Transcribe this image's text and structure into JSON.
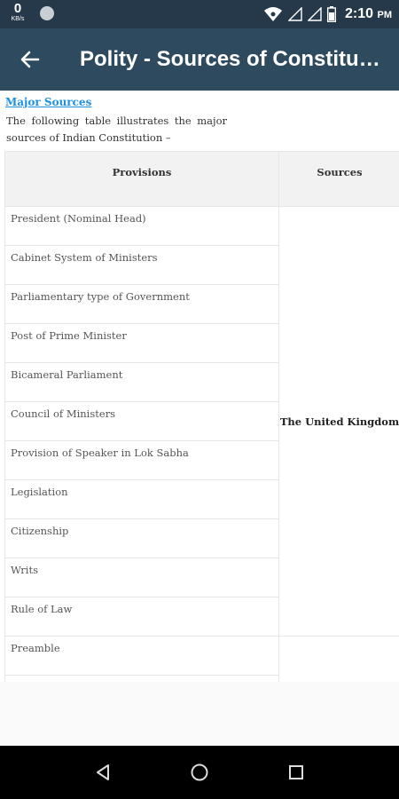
{
  "status": {
    "speed_value": "0",
    "speed_unit": "KB/s",
    "time": "2:10",
    "ampm": "PM"
  },
  "app_bar": {
    "title": "Polity - Sources of Constitution"
  },
  "content": {
    "section_heading": "Major Sources",
    "intro": "The following table illustrates the major sources of Indian Constitution –",
    "table": {
      "headers": [
        "Provisions",
        "Sources"
      ],
      "rows": [
        "President (Nominal Head)",
        "Cabinet System of Ministers",
        "Parliamentary type of Government",
        "Post of Prime Minister",
        "Bicameral Parliament",
        "Council of Ministers",
        "Provision of Speaker in Lok Sabha",
        "Legislation",
        "Citizenship",
        "Writs",
        "Rule of Law",
        "Preamble",
        ""
      ],
      "source_group": "The United Kingdom"
    }
  },
  "colors": {
    "status_bar": "#26394a",
    "app_bar": "#2e4a5f",
    "link": "#1e90e0",
    "header_bg": "#f2f2f2"
  },
  "icons": [
    "back-arrow-icon",
    "wifi-icon",
    "signal-icon",
    "battery-icon",
    "nav-back-icon",
    "nav-home-icon",
    "nav-recents-icon"
  ]
}
